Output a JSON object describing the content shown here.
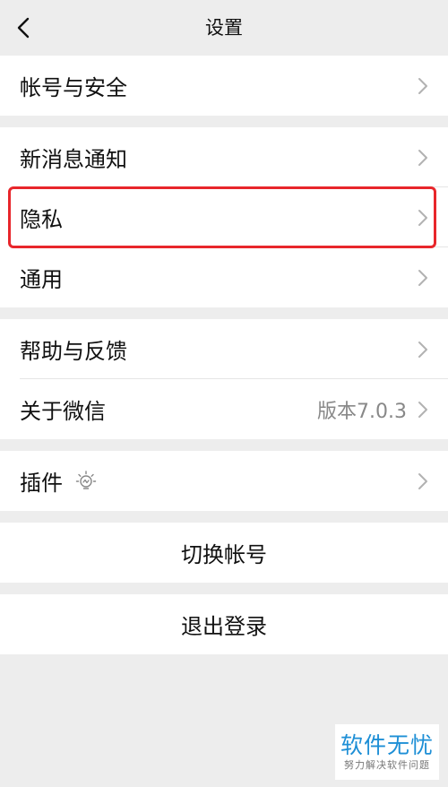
{
  "navbar": {
    "title": "设置"
  },
  "groups": {
    "account": {
      "label": "帐号与安全"
    },
    "notifications": {
      "label": "新消息通知"
    },
    "privacy": {
      "label": "隐私"
    },
    "general": {
      "label": "通用"
    },
    "help": {
      "label": "帮助与反馈"
    },
    "about": {
      "label": "关于微信",
      "value": "版本7.0.3"
    },
    "plugins": {
      "label": "插件"
    }
  },
  "actions": {
    "switch_account": "切换帐号",
    "logout": "退出登录"
  },
  "watermark": {
    "main": "软件无忧",
    "sub": "努力解决软件问题"
  },
  "colors": {
    "background": "#ededed",
    "highlight": "#e8262b",
    "watermark": "#1e8fd6"
  },
  "icons": {
    "back": "chevron-left-icon",
    "row_arrow": "chevron-right-icon",
    "plugin": "lightbulb-icon"
  }
}
